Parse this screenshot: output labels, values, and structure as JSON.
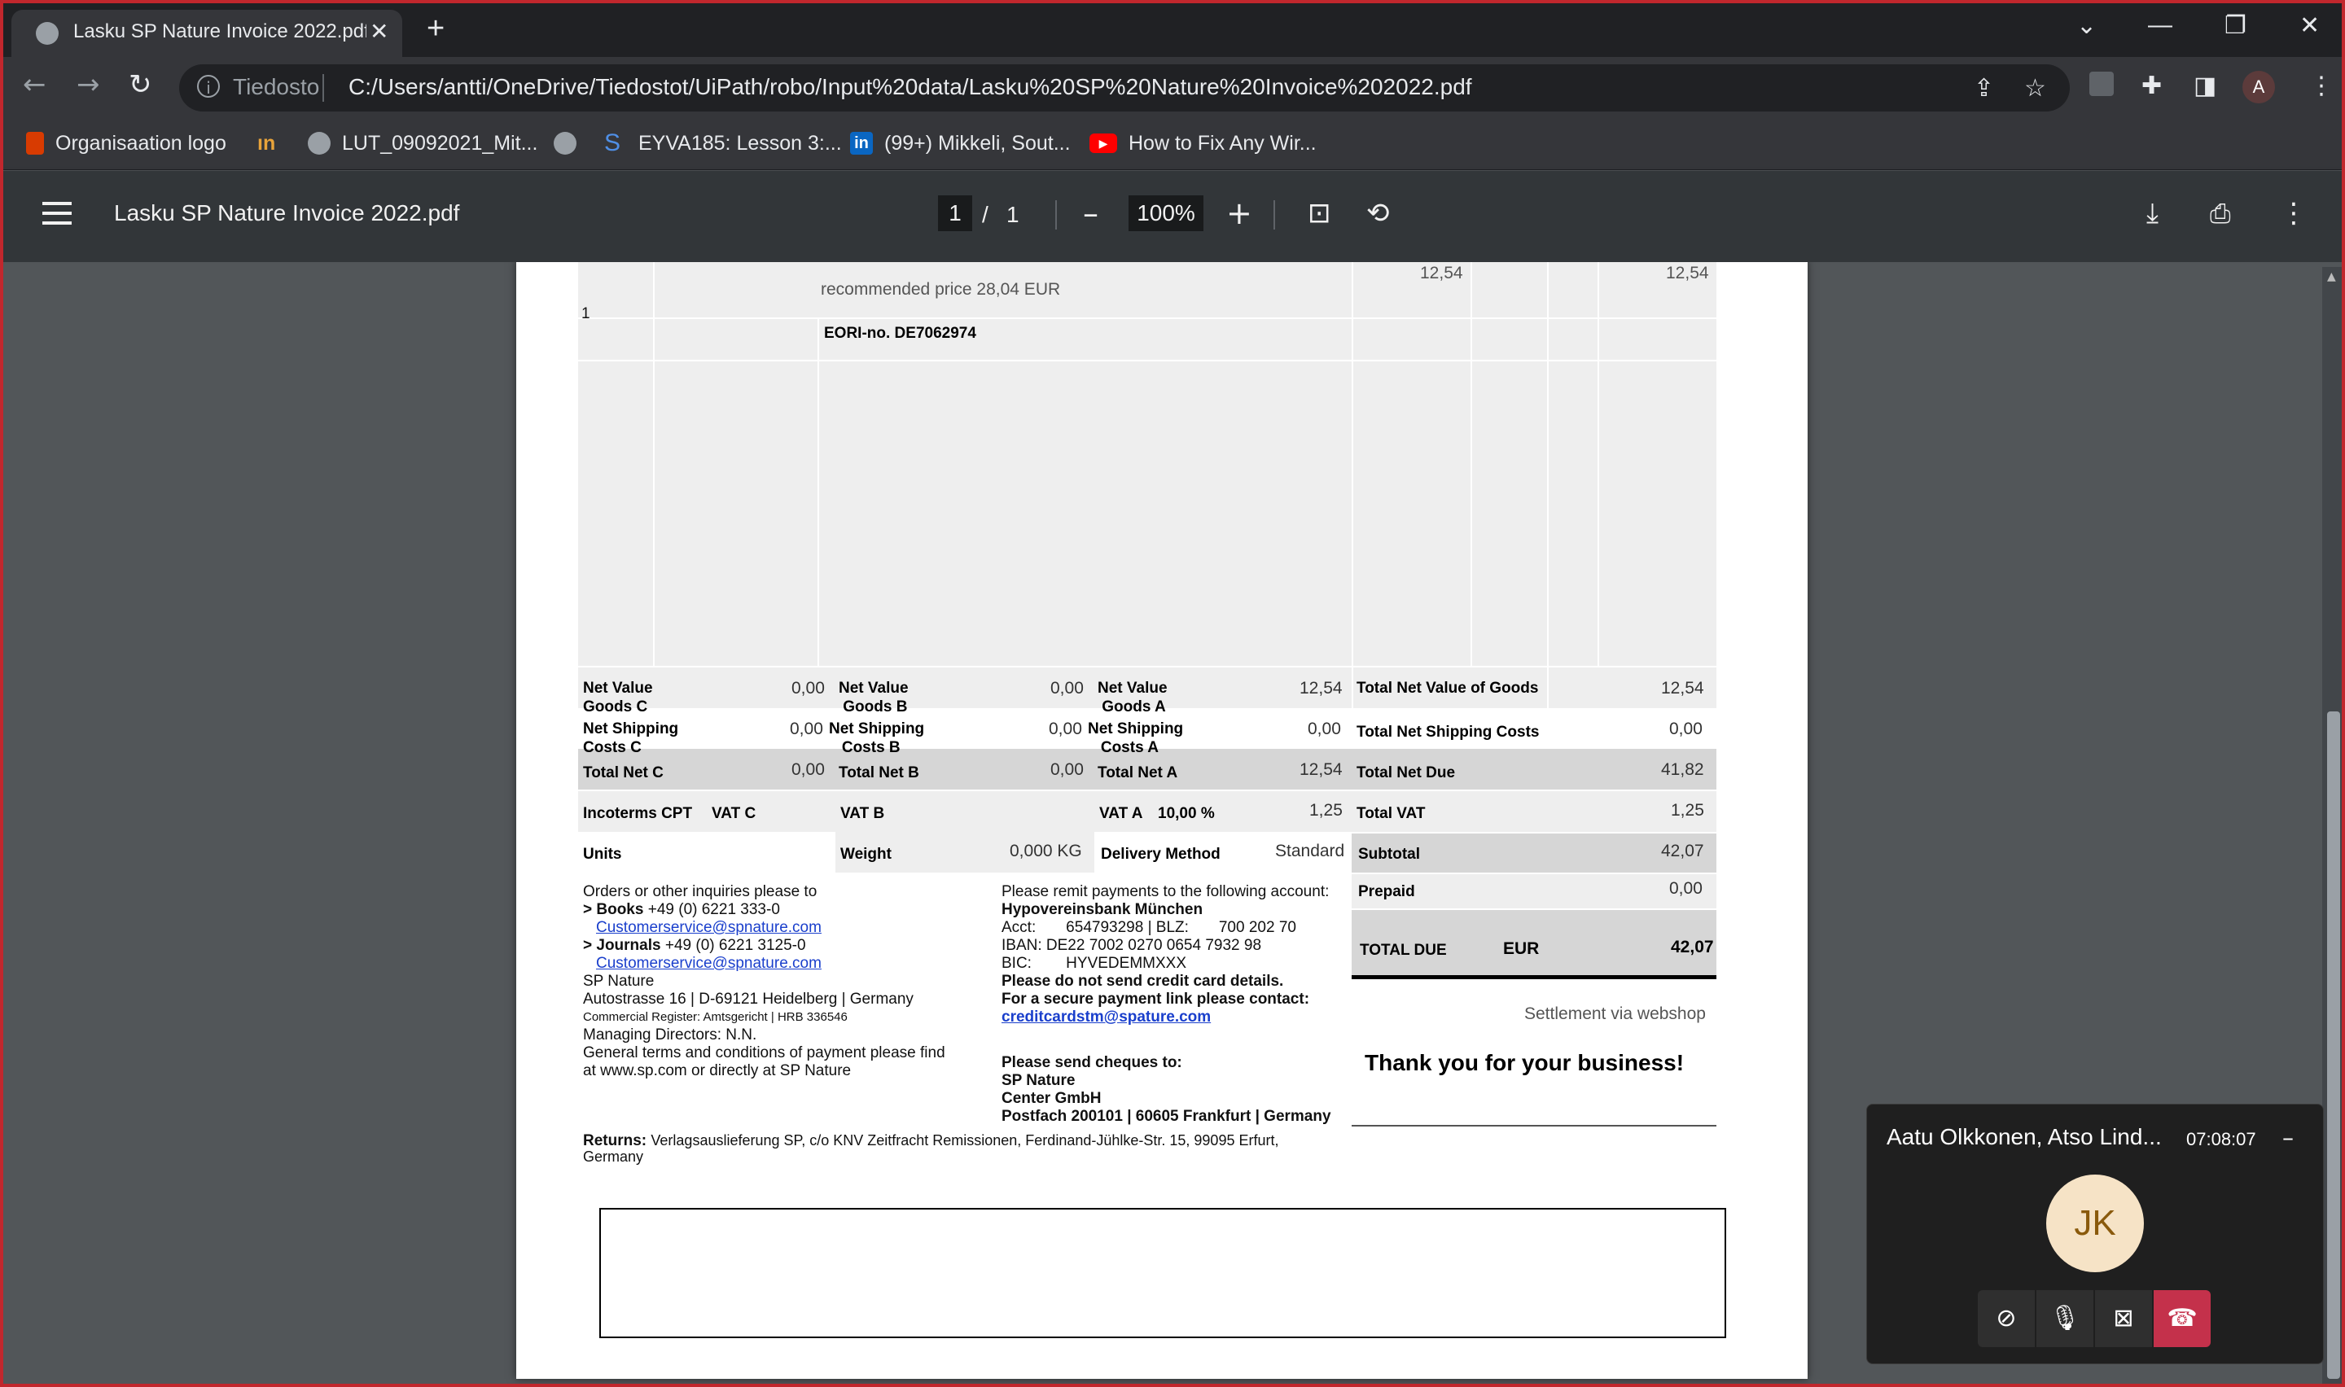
{
  "browser": {
    "tab_title": "Lasku SP Nature Invoice 2022.pdf",
    "tab_close": "✕",
    "new_tab": "+",
    "omnibox_label": "Tiedosto",
    "url": "C:/Users/antti/OneDrive/Tiedostot/UiPath/robo/Input%20data/Lasku%20SP%20Nature%20Invoice%202022.pdf",
    "profile_initial": "A",
    "bookmarks": [
      {
        "label": "Organisaation logo",
        "icon": "office-icon",
        "color": "#d83b01"
      },
      {
        "label": "",
        "icon": "in-logo-icon",
        "color": "#e8a33a"
      },
      {
        "label": "LUT_09092021_Mit...",
        "icon": "globe-icon",
        "color": "#9aa0a6"
      },
      {
        "label": "",
        "icon": "globe-icon",
        "color": "#9aa0a6"
      },
      {
        "label": "EYVA185: Lesson 3:...",
        "icon": "s-logo-icon",
        "color": "#4f8fe6"
      },
      {
        "label": "(99+) Mikkeli, Sout...",
        "icon": "linkedin-icon",
        "color": "#0a66c2"
      },
      {
        "label": "How to Fix Any Wir...",
        "icon": "youtube-icon",
        "color": "#ff0000"
      }
    ]
  },
  "pdf_toolbar": {
    "title": "Lasku SP Nature Invoice 2022.pdf",
    "current_page": "1",
    "page_sep": "/",
    "total_pages": "1",
    "zoom": "100%",
    "minus": "–",
    "plus": "+"
  },
  "invoice": {
    "item_qty": "1",
    "item_recommended": "recommended price 28,04 EUR",
    "item_price": "12,54",
    "item_total": "12,54",
    "eori": "EORI-no. DE7062974",
    "summary": {
      "net_value_goods_c_label1": "Net Value",
      "net_value_goods_c_label2": "Goods C",
      "net_value_goods_c": "0,00",
      "net_value_goods_b_label1": "Net Value",
      "net_value_goods_b_label2": "Goods B",
      "net_value_goods_b": "0,00",
      "net_value_goods_a_label1": "Net Value",
      "net_value_goods_a_label2": "Goods A",
      "net_value_goods_a": "12,54",
      "total_net_value_goods_label": "Total Net Value of Goods",
      "total_net_value_goods": "12,54",
      "net_shipping_c_label1": "Net Shipping",
      "net_shipping_c_label2": "Costs C",
      "net_shipping_c": "0,00",
      "net_shipping_b_label1": "Net Shipping",
      "net_shipping_b_label2": "Costs B",
      "net_shipping_b": "0,00",
      "net_shipping_a_label1": "Net Shipping",
      "net_shipping_a_label2": "Costs A",
      "net_shipping_a": "0,00",
      "total_net_shipping_label": "Total Net Shipping Costs",
      "total_net_shipping": "0,00",
      "total_net_c_label": "Total Net C",
      "total_net_c": "0,00",
      "total_net_b_label": "Total Net B",
      "total_net_b": "0,00",
      "total_net_a_label": "Total Net A",
      "total_net_a": "12,54",
      "total_net_due_label": "Total Net Due",
      "total_net_due": "41,82",
      "incoterms_label": "Incoterms CPT",
      "vat_c_label": "VAT C",
      "vat_b_label": "VAT B",
      "vat_a_label": "VAT A",
      "vat_a_rate": "10,00 %",
      "vat_a": "1,25",
      "total_vat_label": "Total VAT",
      "total_vat": "1,25",
      "units_label": "Units",
      "weight_label": "Weight",
      "weight": "0,000  KG",
      "delivery_method_label": "Delivery Method",
      "delivery_method": "Standard",
      "subtotal_label": "Subtotal",
      "subtotal": "42,07",
      "prepaid_label": "Prepaid",
      "prepaid": "0,00",
      "total_due_label": "TOTAL DUE",
      "total_due_currency": "EUR",
      "total_due": "42,07",
      "settlement": "Settlement via webshop",
      "thank_you": "Thank you for your business!"
    },
    "contact": {
      "intro": "Orders or other inquiries please to",
      "books_label": "> Books",
      "books_phone": "+49 (0) 6221 333-0",
      "books_email": "Customerservice@spnature.com",
      "journals_label": "> Journals",
      "journals_phone": "+49 (0) 6221 3125-0",
      "journals_email": "Customerservice@spnature.com",
      "company": "SP Nature",
      "address": "Autostrasse 16 | D-69121 Heidelberg | Germany",
      "register": "Commercial Register: Amtsgericht | HRB 336546",
      "directors": "Managing Directors: N.N.",
      "terms1": "General terms and conditions of payment please find",
      "terms2": "at www.sp.com or directly at SP Nature",
      "returns_label": "Returns:",
      "returns1": "Verlagsauslieferung SP, c/o KNV Zeitfracht Remissionen, Ferdinand-Jühlke-Str. 15, 99095 Erfurt,",
      "returns2": "Germany"
    },
    "payment": {
      "intro": "Please remit payments to the following account:",
      "bank": "Hypovereinsbank München",
      "acct": "Acct:       654793298 | BLZ:       700 202 70",
      "iban": "IBAN: DE22 7002 0270 0654 7932 98",
      "bic": "BIC:        HYVEDEMMXXX",
      "no_card": "Please do not send credit card details.",
      "secure_link": "For a secure payment link please contact:",
      "card_email": "creditcardstm@spature.com",
      "cheques": "Please send cheques to:",
      "cheque1": "SP Nature",
      "cheque2": "Center GmbH",
      "cheque3": "Postfach 200101 | 60605 Frankfurt | Germany"
    }
  },
  "meeting": {
    "title": "Aatu Olkkonen, Atso Lind...",
    "time": "07:08:07",
    "initials": "JK"
  }
}
